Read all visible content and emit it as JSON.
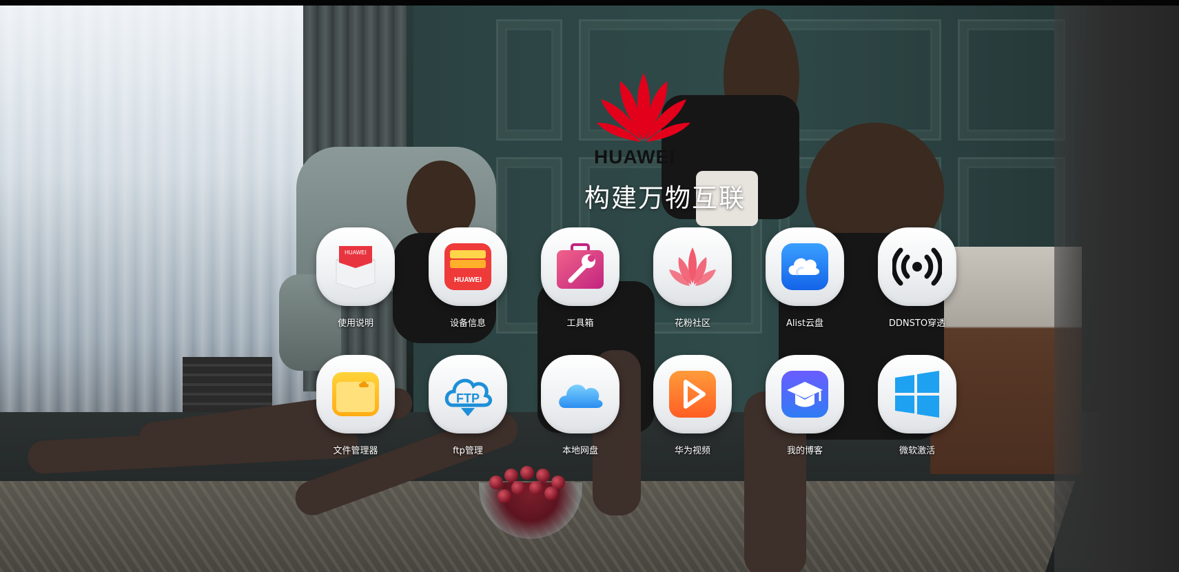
{
  "page": {
    "brand": "HUAWEI",
    "slogan": "构建万物互联"
  },
  "apps": [
    {
      "label": "使用说明",
      "icon": "manual-icon",
      "badge": "HUAWEI"
    },
    {
      "label": "设备信息",
      "icon": "device-info-icon",
      "badge": "HUAWEI"
    },
    {
      "label": "工具箱",
      "icon": "toolbox-icon"
    },
    {
      "label": "花粉社区",
      "icon": "lotus-community-icon"
    },
    {
      "label": "Alist云盘",
      "icon": "alist-cloud-icon"
    },
    {
      "label": "DDNSTO穿透",
      "icon": "broadcast-icon"
    },
    {
      "label": "文件管理器",
      "icon": "folder-icon"
    },
    {
      "label": "ftp管理",
      "icon": "ftp-cloud-icon",
      "badge": "FTP"
    },
    {
      "label": "本地网盘",
      "icon": "icloud-icon"
    },
    {
      "label": "华为视频",
      "icon": "video-play-icon"
    },
    {
      "label": "我的博客",
      "icon": "graduation-cap-icon"
    },
    {
      "label": "微软激活",
      "icon": "windows-logo-icon"
    }
  ],
  "colors": {
    "huawei_red": "#e3001b",
    "windows_blue": "#1ea1f1",
    "alist_blue": "#1677ff",
    "folder_yellow": "#ffc21a",
    "video_orange": "#ff7a2f",
    "blog_purple": "#5b4cf0"
  }
}
